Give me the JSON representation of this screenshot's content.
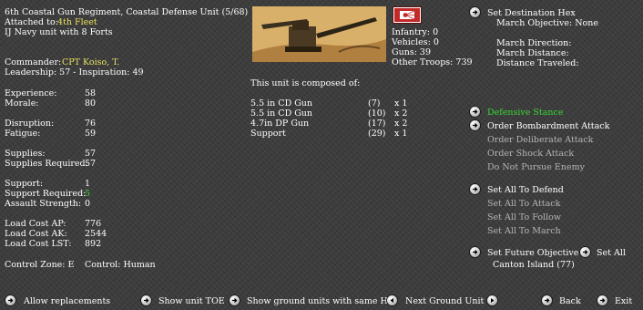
{
  "unit": {
    "name": "6th Coastal Gun Regiment, Coastal Defense Unit (5/68)",
    "attached_label": "Attached to:",
    "attached_value": "4th Fleet",
    "navy_line": "IJ Navy unit with 8 Forts",
    "commander_label": "Commander:",
    "commander_value": "CPT Koiso, T.",
    "leadership_line": "Leadership: 57 - Inspiration: 49"
  },
  "stats": [
    {
      "label": "Experience:",
      "value": "58"
    },
    {
      "label": "Morale:",
      "value": "80"
    },
    {
      "label": "Disruption:",
      "value": "76"
    },
    {
      "label": "Fatigue:",
      "value": "59"
    },
    {
      "label": "Supplies:",
      "value": "57"
    },
    {
      "label": "Supplies Required:",
      "value": "57"
    },
    {
      "label": "Support:",
      "value": "1"
    },
    {
      "label": "Support Required:",
      "value": "5"
    },
    {
      "label": "Assault Strength:",
      "value": "0"
    },
    {
      "label": "Load Cost AP:",
      "value": "776"
    },
    {
      "label": "Load Cost AK:",
      "value": "2544"
    },
    {
      "label": "Load Cost LST:",
      "value": "892"
    }
  ],
  "control": {
    "zone": "Control Zone: E",
    "control": "Control: Human"
  },
  "troops": {
    "infantry": "Infantry: 0",
    "vehicles": "Vehicles: 0",
    "guns": "Guns: 39",
    "other": "Other Troops: 739"
  },
  "composition": {
    "header": "This unit is composed of:",
    "rows": [
      {
        "name": "5.5 in CD Gun",
        "id": "(7)",
        "qty": "x  1"
      },
      {
        "name": "5.5 in CD Gun",
        "id": "(10)",
        "qty": "x  2"
      },
      {
        "name": "4.7in DP Gun",
        "id": "(17)",
        "qty": "x  2"
      },
      {
        "name": "Support",
        "id": "(29)",
        "qty": "x  1"
      }
    ]
  },
  "destination": {
    "button": "Set Destination Hex",
    "objective": "March Objective: None",
    "direction": "March Direction:",
    "distance": "March Distance:",
    "traveled": "Distance Traveled:"
  },
  "stance": {
    "defensive": "Defensive Stance",
    "bombardment": "Order Bombardment Attack",
    "deliberate": "Order Deliberate Attack",
    "shock": "Order Shock Attack",
    "no_pursue": "Do Not Pursue Enemy"
  },
  "orders": {
    "defend": "Set All To Defend",
    "attack": "Set All To Attack",
    "follow": "Set All To Follow",
    "march": "Set All To March"
  },
  "future": {
    "button": "Set Future Objective",
    "set_all": "Set All",
    "target": "Canton Island (77)"
  },
  "bottom": {
    "replacements": "Allow replacements",
    "toe": "Show unit TOE",
    "same_hq": "Show ground units with same HQ",
    "next_unit": "Next Ground Unit",
    "back": "Back",
    "exit": "Exit"
  },
  "colors": {
    "background": "#3a3a3a",
    "highlight_yellow": "#e8e060",
    "active_green": "#38d838",
    "disabled_grey": "#b4b4b4"
  }
}
